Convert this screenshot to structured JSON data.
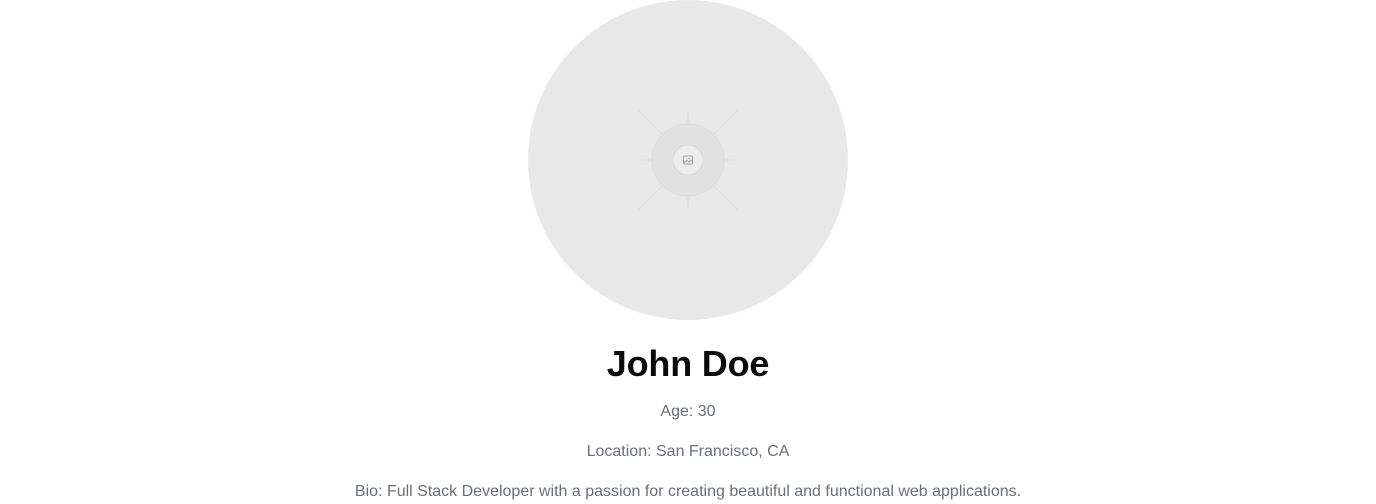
{
  "profile": {
    "avatar_icon": "image-placeholder-icon",
    "name": "John Doe",
    "age_text": "Age: 30",
    "location_text": "Location: San Francisco, CA",
    "bio_text": "Bio: Full Stack Developer with a passion for creating beautiful and functional web applications."
  },
  "colors": {
    "background": "#ffffff",
    "avatar_fill": "#e8e8e8",
    "name_text": "#0b0b0b",
    "secondary_text": "#6b6f76"
  }
}
